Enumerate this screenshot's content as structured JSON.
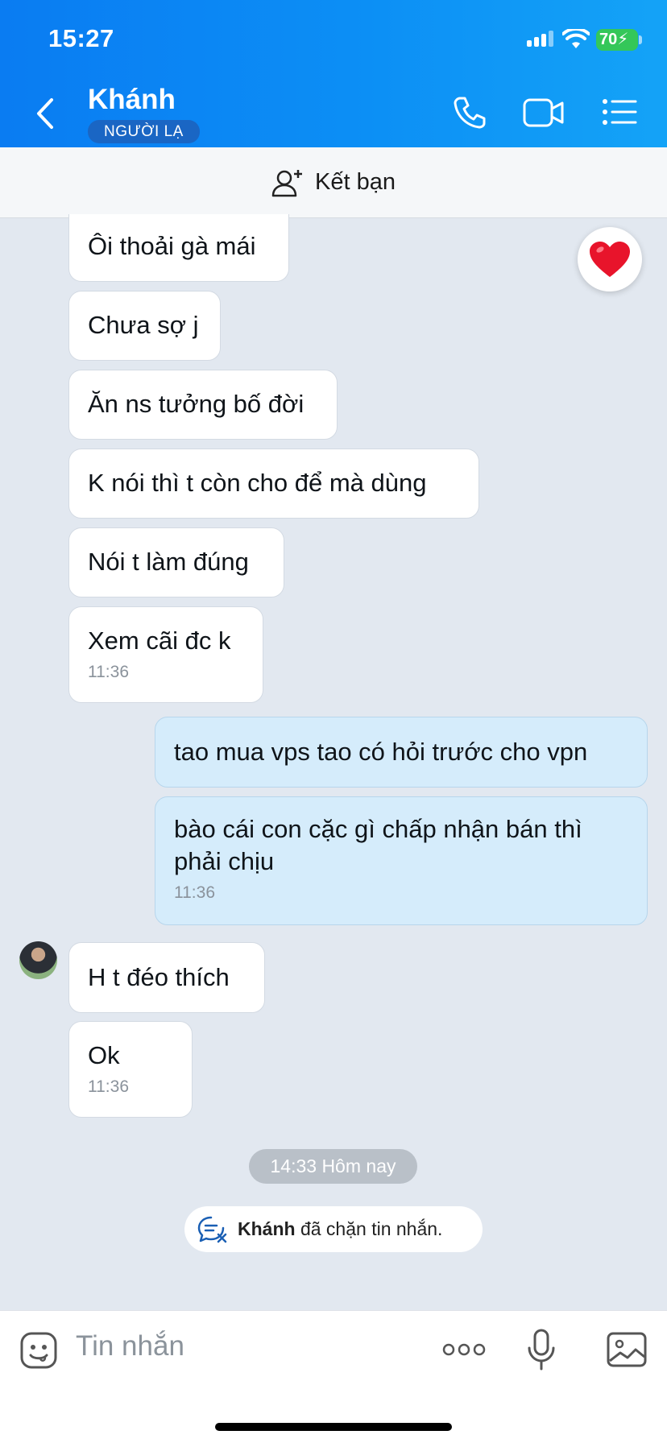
{
  "status_bar": {
    "time": "15:27",
    "battery": "70"
  },
  "header": {
    "contact_name": "Khánh",
    "stranger_badge": "NGƯỜI LẠ",
    "back_icon": "chevron-left-icon",
    "call_icon": "phone-icon",
    "video_icon": "video-camera-icon",
    "menu_icon": "list-menu-icon"
  },
  "add_friend": {
    "label": "Kết bạn",
    "icon": "add-person-icon"
  },
  "messages": [
    {
      "side": "them",
      "text": "Ôi thoải gà mái"
    },
    {
      "side": "them",
      "text": "Chưa sợ j"
    },
    {
      "side": "them",
      "text": "Ăn ns tưởng bố đời"
    },
    {
      "side": "them",
      "text": "K nói thì t còn cho để mà dùng"
    },
    {
      "side": "them",
      "text": "Nói t làm đúng"
    },
    {
      "side": "them",
      "text": "Xem cãi đc k",
      "time": "11:36"
    },
    {
      "side": "me",
      "text": "tao mua vps tao có hỏi trước cho vpn"
    },
    {
      "side": "me",
      "text": "bào cái con cặc gì chấp nhận bán thì phải chịu",
      "time": "11:36"
    },
    {
      "side": "them",
      "text": "H t đéo thích"
    },
    {
      "side": "them",
      "text": "Ok",
      "time": "11:36"
    }
  ],
  "reaction": "heart-icon",
  "date_separator": "14:33 Hôm nay",
  "system_notice": {
    "name": "Khánh",
    "text": "đã chặn tin nhắn."
  },
  "input": {
    "placeholder": "Tin nhắn",
    "emoji_icon": "sticker-icon",
    "more_icon": "more-dots-icon",
    "mic_icon": "microphone-icon",
    "image_icon": "image-icon"
  },
  "colors": {
    "header_blue": "#0a7cf2",
    "my_bubble": "#d5ecfb",
    "chat_bg": "#e2e8f0"
  }
}
